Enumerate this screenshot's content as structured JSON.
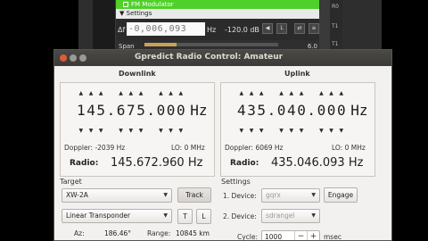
{
  "background": {
    "module_title": "FM Modulator",
    "settings_label": "Settings",
    "delta_symbol": "Δf",
    "frequency_value": "-0,006,093",
    "frequency_unit": "Hz",
    "level_value": "-120.0 dB",
    "span_label": "Span",
    "span_value": "6.0",
    "side_tabs": [
      "R0",
      "T1",
      "T1"
    ]
  },
  "dialog": {
    "title": "Gpredict Radio Control: Amateur",
    "downlink": {
      "label": "Downlink",
      "digits": [
        "1",
        "4",
        "5",
        ".",
        "6",
        "7",
        "5",
        ".",
        "0",
        "0",
        "0"
      ],
      "unit": "Hz",
      "doppler": "Doppler: -2039 Hz",
      "lo": "LO: 0 MHz",
      "radio_label": "Radio:",
      "radio_value": "145.672.960 Hz"
    },
    "uplink": {
      "label": "Uplink",
      "digits": [
        "4",
        "3",
        "5",
        ".",
        "0",
        "4",
        "0",
        ".",
        "0",
        "0",
        "0"
      ],
      "unit": "Hz",
      "doppler": "Doppler: 6069 Hz",
      "lo": "LO: 0 MHz",
      "radio_label": "Radio:",
      "radio_value": "435.046.093 Hz"
    },
    "target": {
      "label": "Target",
      "satellite": "XW-2A",
      "track_button": "Track",
      "transponder": "Linear Transponder",
      "t_button": "T",
      "l_button": "L",
      "az_label": "Az:",
      "az_value": "186.46°",
      "range_label": "Range:",
      "range_value": "10845 km"
    },
    "settings": {
      "label": "Settings",
      "device1_label": "1. Device:",
      "device1_value": "gqrx",
      "engage_button": "Engage",
      "device2_label": "2. Device:",
      "device2_value": "sdrangel",
      "cycle_label": "Cycle:",
      "cycle_value": "1000",
      "cycle_minus": "−",
      "cycle_plus": "+",
      "cycle_unit": "msec"
    }
  }
}
